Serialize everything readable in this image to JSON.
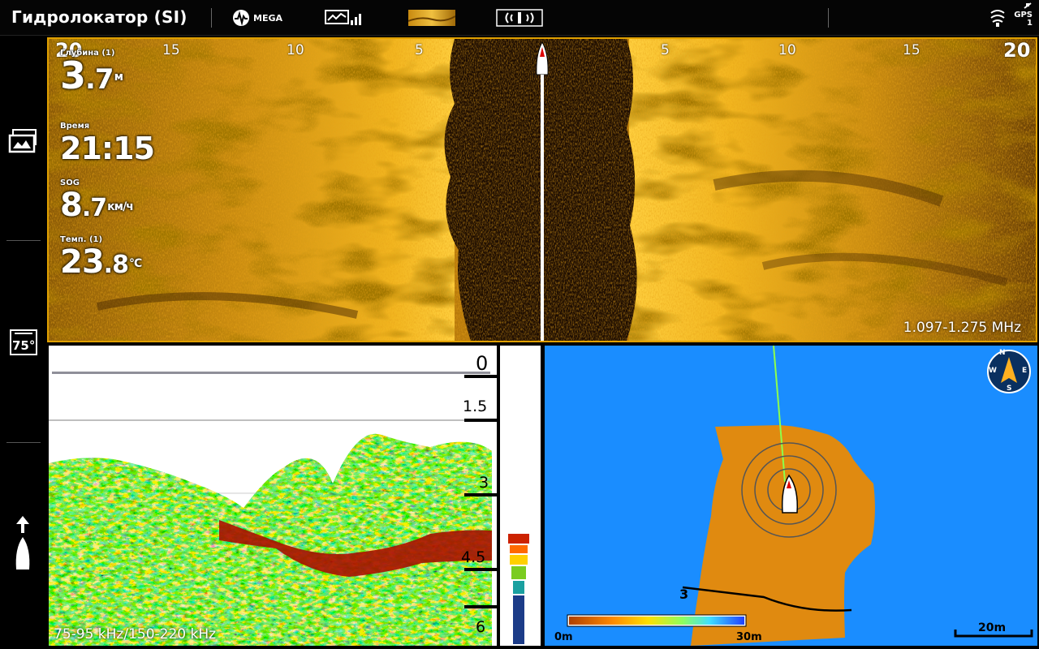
{
  "header": {
    "title": "Гидролокатор (SI)",
    "mega_label": "MEGA",
    "gps_label": "GPS",
    "gps_count": "1"
  },
  "side_imaging": {
    "left_scale": [
      "20",
      "15",
      "10",
      "5"
    ],
    "right_scale": [
      "5",
      "10",
      "15",
      "20"
    ],
    "frequency": "1.097-1.275 MHz",
    "readouts": {
      "depth": {
        "label": "Глубина (1)",
        "int": "3",
        "dec": ".7",
        "unit": "м"
      },
      "time": {
        "label": "Время",
        "value": "21:15"
      },
      "sog": {
        "label": "SOG",
        "int": "8",
        "dec": ".7",
        "unit": "км/ч"
      },
      "temp": {
        "label": "Темп. (1)",
        "int": "23",
        "dec": ".8",
        "unit": "°C"
      }
    }
  },
  "sonar": {
    "depth_labels": [
      "0",
      "1.5",
      "3",
      "4.5",
      "6"
    ],
    "frequency": "75-95 kHz/150-220 kHz"
  },
  "map": {
    "contour_label": "3",
    "legend_min": "0m",
    "legend_max": "30m",
    "scale_label": "20m",
    "compass": [
      "N",
      "E",
      "S",
      "W"
    ]
  },
  "left_rail": {
    "temp_badge": "75°"
  },
  "colors": {
    "accent_frame": "#e0a000",
    "water": "#1a8dff",
    "land": "#e08a10",
    "sonar_bg": "#ffffff"
  }
}
